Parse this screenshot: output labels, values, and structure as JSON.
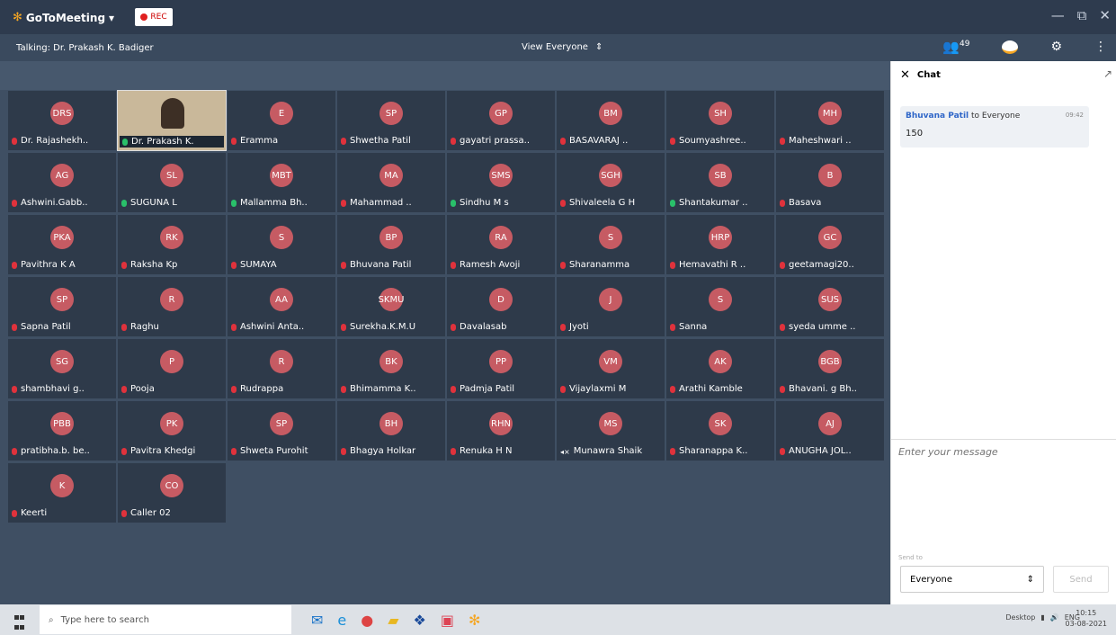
{
  "window": {
    "app_name": "GoToMeeting",
    "rec_label": "REC",
    "minimize": "—",
    "restore": "⧉",
    "close": "✕"
  },
  "subbar": {
    "talking": "Talking: Dr. Prakash K. Badiger",
    "view": "View Everyone",
    "participant_count": "49"
  },
  "tiles": [
    {
      "initials": "DRS",
      "name": "Dr. Rajashekh..",
      "mic": "muted"
    },
    {
      "initials": "",
      "name": "Dr. Prakash K.",
      "mic": "on",
      "video": true
    },
    {
      "initials": "E",
      "name": "Eramma",
      "mic": "muted"
    },
    {
      "initials": "SP",
      "name": "Shwetha Patil",
      "mic": "muted"
    },
    {
      "initials": "GP",
      "name": "gayatri prassa..",
      "mic": "muted"
    },
    {
      "initials": "BM",
      "name": "BASAVARAJ ..",
      "mic": "muted"
    },
    {
      "initials": "SH",
      "name": "Soumyashree..",
      "mic": "muted"
    },
    {
      "initials": "MH",
      "name": "Maheshwari ..",
      "mic": "muted"
    },
    {
      "initials": "AG",
      "name": "Ashwini.Gabb..",
      "mic": "muted"
    },
    {
      "initials": "SL",
      "name": "SUGUNA L",
      "mic": "on"
    },
    {
      "initials": "MBT",
      "name": "Mallamma Bh..",
      "mic": "on"
    },
    {
      "initials": "MA",
      "name": "Mahammad ..",
      "mic": "muted"
    },
    {
      "initials": "SMS",
      "name": "Sindhu M s",
      "mic": "on"
    },
    {
      "initials": "SGH",
      "name": "Shivaleela G H",
      "mic": "muted"
    },
    {
      "initials": "SB",
      "name": "Shantakumar ..",
      "mic": "on"
    },
    {
      "initials": "B",
      "name": "Basava",
      "mic": "muted"
    },
    {
      "initials": "PKA",
      "name": "Pavithra K A",
      "mic": "muted"
    },
    {
      "initials": "RK",
      "name": "Raksha Kp",
      "mic": "muted"
    },
    {
      "initials": "S",
      "name": "SUMAYA",
      "mic": "muted"
    },
    {
      "initials": "BP",
      "name": "Bhuvana Patil",
      "mic": "muted"
    },
    {
      "initials": "RA",
      "name": "Ramesh Avoji",
      "mic": "muted"
    },
    {
      "initials": "S",
      "name": "Sharanamma",
      "mic": "muted"
    },
    {
      "initials": "HRP",
      "name": "Hemavathi R ..",
      "mic": "muted"
    },
    {
      "initials": "GC",
      "name": "geetamagi20..",
      "mic": "muted"
    },
    {
      "initials": "SP",
      "name": "Sapna Patil",
      "mic": "muted"
    },
    {
      "initials": "R",
      "name": "Raghu",
      "mic": "muted"
    },
    {
      "initials": "AA",
      "name": "Ashwini Anta..",
      "mic": "muted"
    },
    {
      "initials": "SKMU",
      "name": "Surekha.K.M.U",
      "mic": "muted"
    },
    {
      "initials": "D",
      "name": "Davalasab",
      "mic": "muted"
    },
    {
      "initials": "J",
      "name": "Jyoti",
      "mic": "muted"
    },
    {
      "initials": "S",
      "name": "Sanna",
      "mic": "muted"
    },
    {
      "initials": "SUS",
      "name": "syeda umme ..",
      "mic": "muted"
    },
    {
      "initials": "SG",
      "name": "shambhavi g..",
      "mic": "muted"
    },
    {
      "initials": "P",
      "name": "Pooja",
      "mic": "muted"
    },
    {
      "initials": "R",
      "name": "Rudrappa",
      "mic": "muted"
    },
    {
      "initials": "BK",
      "name": "Bhimamma K..",
      "mic": "muted"
    },
    {
      "initials": "PP",
      "name": "Padmja Patil",
      "mic": "muted"
    },
    {
      "initials": "VM",
      "name": "Vijaylaxmi M",
      "mic": "muted"
    },
    {
      "initials": "AK",
      "name": "Arathi Kamble",
      "mic": "muted"
    },
    {
      "initials": "BGB",
      "name": "Bhavani. g Bh..",
      "mic": "muted"
    },
    {
      "initials": "PBB",
      "name": "pratibha.b. be..",
      "mic": "muted"
    },
    {
      "initials": "PK",
      "name": "Pavitra Khedgi",
      "mic": "muted"
    },
    {
      "initials": "SP",
      "name": "Shweta Purohit",
      "mic": "muted"
    },
    {
      "initials": "BH",
      "name": "Bhagya Holkar",
      "mic": "muted"
    },
    {
      "initials": "RHN",
      "name": "Renuka H N",
      "mic": "muted"
    },
    {
      "initials": "MS",
      "name": "Munawra Shaik",
      "mic": "speaker"
    },
    {
      "initials": "SK",
      "name": "Sharanappa K..",
      "mic": "muted"
    },
    {
      "initials": "AJ",
      "name": "ANUGHA JOL..",
      "mic": "muted"
    },
    {
      "initials": "K",
      "name": "Keerti",
      "mic": "muted"
    },
    {
      "initials": "CO",
      "name": "Caller 02",
      "mic": "muted"
    }
  ],
  "chat": {
    "title": "Chat",
    "message": {
      "from": "Bhuvana Patil",
      "to_text": "to Everyone",
      "time": "09:42",
      "body": "150"
    },
    "input_placeholder": "Enter your message",
    "send_to_label": "Send to",
    "send_to_value": "Everyone",
    "send_label": "Send"
  },
  "taskbar": {
    "search_placeholder": "Type here to search",
    "desktop_label": "Desktop",
    "lang": "ENG",
    "time": "10:15",
    "date": "03-08-2021"
  }
}
